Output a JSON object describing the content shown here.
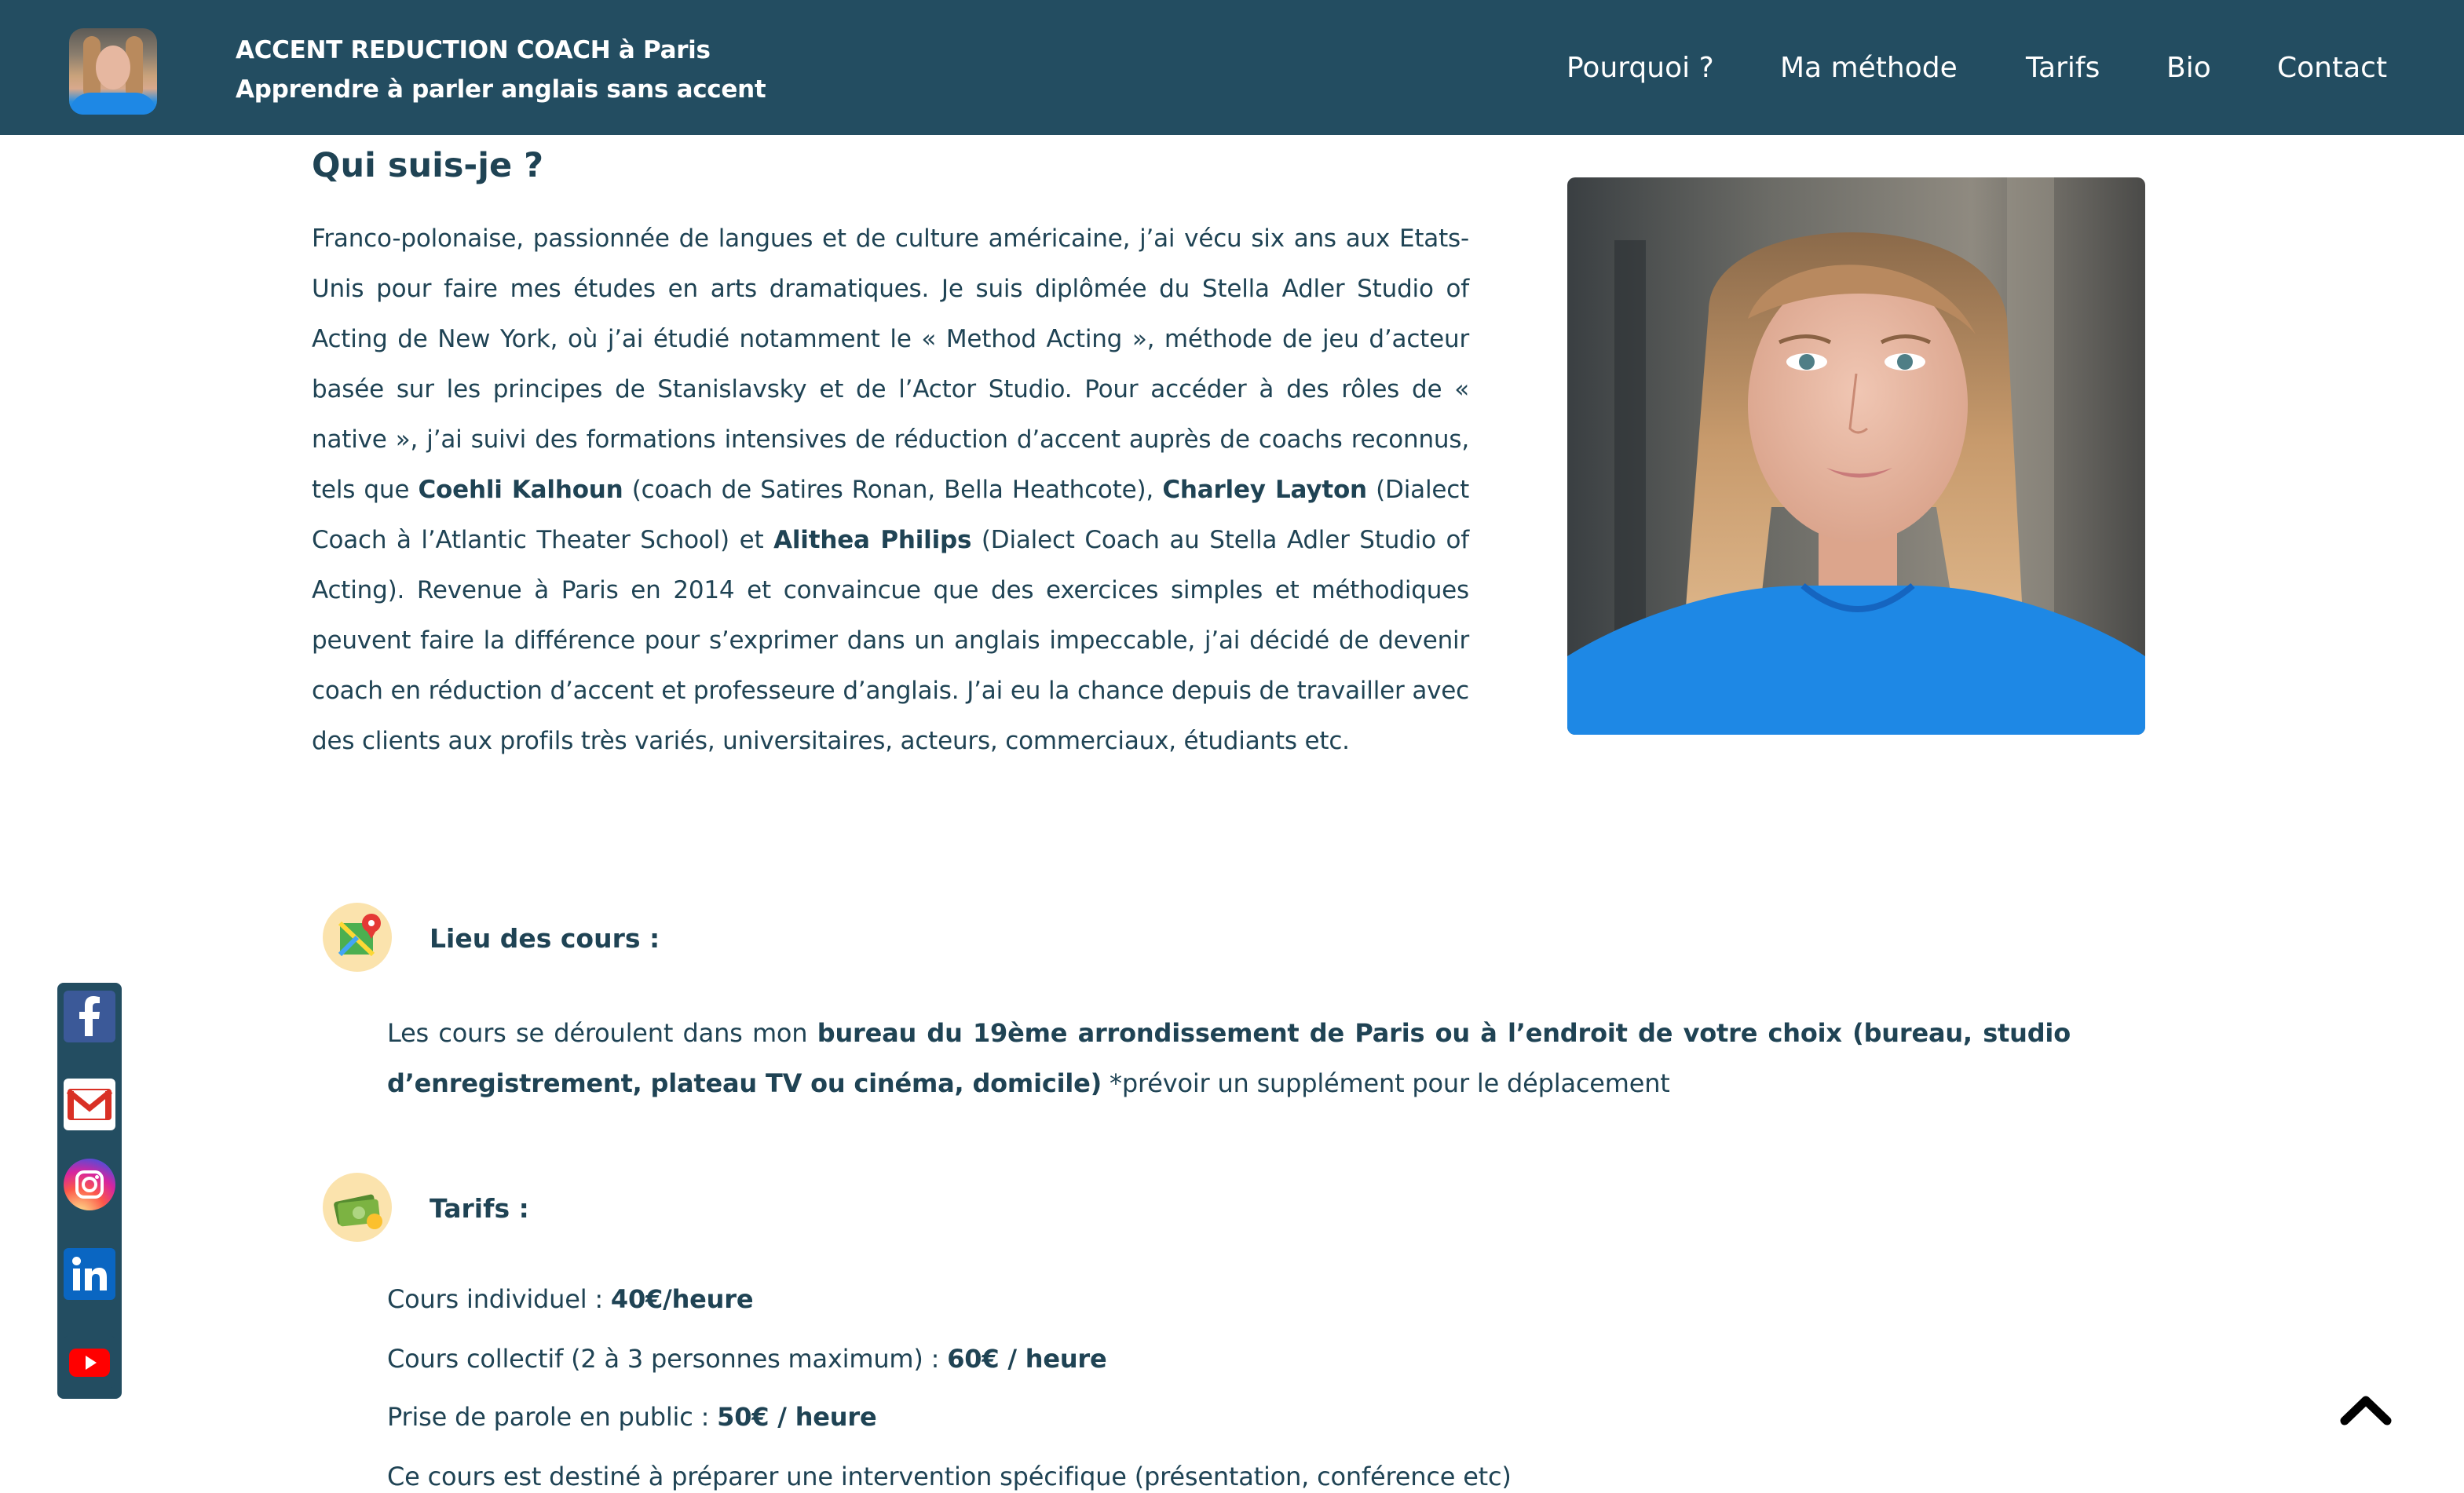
{
  "header": {
    "title": "ACCENT REDUCTION COACH à Paris",
    "subtitle": "Apprendre à parler anglais sans accent",
    "nav": [
      "Pourquoi ?",
      "Ma méthode",
      "Tarifs",
      "Bio",
      "Contact"
    ]
  },
  "bio": {
    "heading": "Qui suis-je ?",
    "text_1": "Franco-polonaise, passionnée de langues et de culture américaine, j’ai vécu six ans aux Etats-Unis pour faire mes études en arts dramatiques. Je suis diplômée du Stella Adler Studio of Acting de New York, où j’ai étudié notamment le « Method Acting », méthode de jeu d’acteur basée sur les principes de Stanislavsky et de l’Actor Studio. Pour accéder à des rôles de « native », j’ai suivi des formations intensives de réduction d’accent auprès de coachs reconnus, tels que ",
    "name_1": "Coehli Kalhoun",
    "text_2": " (coach de Satires Ronan, Bella Heathcote), ",
    "name_2": "Charley Layton",
    "text_3": " (Dialect Coach à l’Atlantic Theater School) et ",
    "name_3": "Alithea Philips",
    "text_4": " (Dialect Coach au Stella Adler Studio of Acting). Revenue à Paris en 2014 et convaincue que des exercices simples et méthodiques peuvent faire la différence pour s’exprimer dans un anglais impeccable, j’ai décidé de devenir coach en réduction d’accent et professeure d’anglais. J’ai eu la chance depuis de travailler avec des clients aux profils très variés, universitaires, acteurs, commerciaux, étudiants etc."
  },
  "lieu": {
    "title": "Lieu des cours :",
    "text_1": "Les cours se déroulent dans mon ",
    "bold": "bureau du 19ème arrondissement de Paris ou à l’endroit de votre choix (bureau, studio d’enregistrement, plateau TV ou cinéma, domicile)",
    "text_2": " *prévoir un supplément pour le déplacement"
  },
  "tarifs": {
    "title": "Tarifs :",
    "items": [
      {
        "label": "Cours individuel : ",
        "price": "40€/heure"
      },
      {
        "label": "Cours collectif (2 à 3 personnes maximum) : ",
        "price": "60€ / heure"
      },
      {
        "label": "Prise de parole en public : ",
        "price": "50€ / heure"
      }
    ],
    "note": "Ce cours est destiné à préparer une intervention spécifique (présentation, conférence etc)"
  },
  "icons": {
    "map": "map-pin-icon",
    "money": "money-icon",
    "facebook": "facebook-icon",
    "gmail": "gmail-icon",
    "instagram": "instagram-icon",
    "linkedin": "linkedin-icon",
    "youtube": "youtube-icon",
    "back_to_top": "chevron-up-icon"
  },
  "colors": {
    "header_bg": "#234d61",
    "text": "#1f4354",
    "shirt_blue": "#1e88e5",
    "icon_circle": "#fbe3ad"
  }
}
